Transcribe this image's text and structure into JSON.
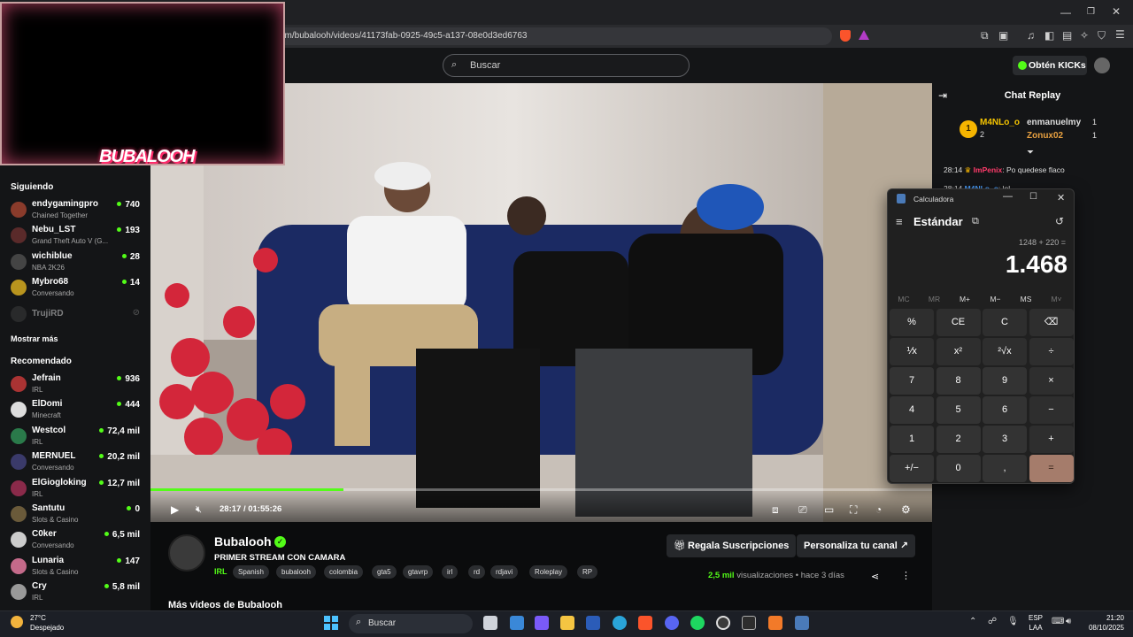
{
  "browser": {
    "url": "om/bubalooh/videos/41173fab-0925-49c5-a137-08e0d3ed6763"
  },
  "header": {
    "search_placeholder": "Buscar",
    "kicks_button": "Obtén KICKs"
  },
  "overlay": {
    "logo_text": "BUBALOOH"
  },
  "sidebar": {
    "following_title": "Siguiendo",
    "following": [
      {
        "name": "endygamingpro",
        "sub": "Chained Together",
        "viewers": "740",
        "color": "#8a3b2b"
      },
      {
        "name": "Nebu_LST",
        "sub": "Grand Theft Auto V (G...",
        "viewers": "193",
        "color": "#5a2a2a"
      },
      {
        "name": "wichiblue",
        "sub": "NBA 2K26",
        "viewers": "28",
        "color": "#444"
      },
      {
        "name": "Mybro68",
        "sub": "Conversando",
        "viewers": "14",
        "color": "#b8941e"
      },
      {
        "name": "TrujiRD",
        "sub": "",
        "viewers": "",
        "color": "#444"
      }
    ],
    "show_more": "Mostrar más",
    "recommended_title": "Recomendado",
    "recommended": [
      {
        "name": "Jefrain",
        "sub": "IRL",
        "viewers": "936",
        "color": "#a33"
      },
      {
        "name": "ElDomi",
        "sub": "Minecraft",
        "viewers": "444",
        "color": "#ddd"
      },
      {
        "name": "Westcol",
        "sub": "IRL",
        "viewers": "72,4 mil",
        "color": "#2a7a4a"
      },
      {
        "name": "MERNUEL",
        "sub": "Conversando",
        "viewers": "20,2 mil",
        "color": "#3a3a6a"
      },
      {
        "name": "ElGiogloking",
        "sub": "IRL",
        "viewers": "12,7 mil",
        "color": "#8a2a4a"
      },
      {
        "name": "Santutu",
        "sub": "Slots & Casino",
        "viewers": "0",
        "color": "#6a5a3a"
      },
      {
        "name": "C0ker",
        "sub": "Conversando",
        "viewers": "6,5 mil",
        "color": "#ccc"
      },
      {
        "name": "Lunaria",
        "sub": "Slots & Casino",
        "viewers": "147",
        "color": "#c46a8a"
      },
      {
        "name": "Cry",
        "sub": "IRL",
        "viewers": "5,8 mil",
        "color": "#999"
      }
    ]
  },
  "player": {
    "current_time": "28:17",
    "separator": "/",
    "duration": "01:55:26",
    "progress_fraction": 0.247
  },
  "channel": {
    "name": "Bubalooh",
    "title": "PRIMER STREAM CON CAMARA",
    "category": "IRL",
    "tags": [
      "Spanish",
      "bubalooh",
      "colombia",
      "gta5",
      "gtavrp",
      "irl",
      "rd",
      "rdjavi",
      "Roleplay",
      "RP"
    ],
    "gift_button": "Regala Suscripciones",
    "customize_button": "Personaliza tu canal",
    "views_count": "2,5 mil",
    "views_label": "visualizaciones",
    "dot": "•",
    "age": "hace 3 días",
    "more_videos": "Más videos de Bubalooh"
  },
  "chat": {
    "title": "Chat Replay",
    "leader1_name": "M4NLo_o",
    "leader1_count": "2",
    "leader2_name": "enmanuelmy",
    "leader2_count": "1",
    "leader3_name": "Zonux02",
    "leader3_count": "1",
    "msg_time": "28:14",
    "msg_user": "ImPenix",
    "msg_text": ": Po quedese flaco",
    "msg2_time": "28:14",
    "msg2_user": "M4NLo_o",
    "msg2_text": ": lol"
  },
  "calculator": {
    "window_title": "Calculadora",
    "mode": "Estándar",
    "expression": "1248 + 220 =",
    "display": "1.468",
    "memory": [
      "MC",
      "MR",
      "M+",
      "M−",
      "MS",
      "M˅"
    ],
    "keys": [
      [
        "%",
        "CE",
        "C",
        "⌫"
      ],
      [
        "⅟x",
        "x²",
        "²√x",
        "÷"
      ],
      [
        "7",
        "8",
        "9",
        "×"
      ],
      [
        "4",
        "5",
        "6",
        "−"
      ],
      [
        "1",
        "2",
        "3",
        "+"
      ],
      [
        "+/−",
        "0",
        ",",
        "="
      ]
    ]
  },
  "taskbar": {
    "weather_temp": "27°C",
    "weather_desc": "Despejado",
    "search_placeholder": "Buscar",
    "lang": "ESP",
    "lang_sub": "LAA",
    "time": "21:20",
    "date": "08/10/2025"
  }
}
